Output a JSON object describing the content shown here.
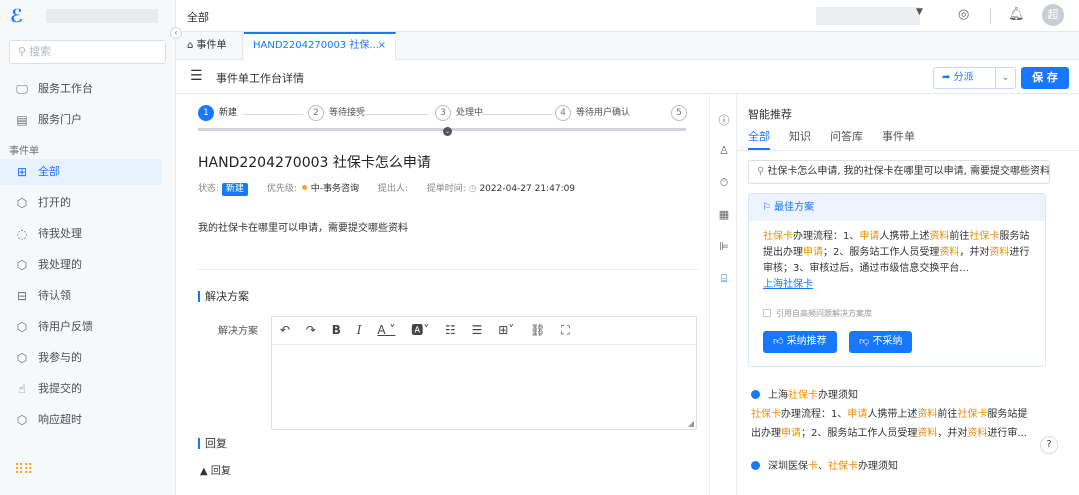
{
  "sidebar": {
    "search_placeholder": "搜索",
    "items_top": [
      {
        "label": "服务工作台",
        "icon": "monitor-icon"
      },
      {
        "label": "服务门户",
        "icon": "layout-icon"
      }
    ],
    "section": "事件单",
    "items": [
      {
        "label": "全部",
        "icon": "grid-icon",
        "active": true
      },
      {
        "label": "打开的",
        "icon": "cube-icon"
      },
      {
        "label": "待我处理",
        "icon": "circle-dashed-icon"
      },
      {
        "label": "我处理的",
        "icon": "cube-icon"
      },
      {
        "label": "待认领",
        "icon": "inbox-icon"
      },
      {
        "label": "待用户反馈",
        "icon": "cube-icon"
      },
      {
        "label": "我参与的",
        "icon": "cube-icon"
      },
      {
        "label": "我提交的",
        "icon": "hand-icon"
      },
      {
        "label": "响应超时",
        "icon": "cube-icon"
      }
    ]
  },
  "topbar": {
    "crumb": "全部",
    "avatar": "超"
  },
  "tabs": {
    "home": "事件单",
    "current": "HAND2204270003 社保...",
    "close": "×"
  },
  "page": {
    "title": "事件单工作台详情",
    "dispatch": "分派",
    "save": "保 存"
  },
  "steps": [
    {
      "num": "1",
      "label": "新建",
      "done": true
    },
    {
      "num": "2",
      "label": "等待接受",
      "done": false
    },
    {
      "num": "3",
      "label": "处理中",
      "done": false
    },
    {
      "num": "4",
      "label": "等待用户确认",
      "done": false
    },
    {
      "num": "5",
      "label": "",
      "done": false
    }
  ],
  "ticket": {
    "title": "HAND2204270003  社保卡怎么申请",
    "status_label": "状态:",
    "status": "新建",
    "priority_label": "优先级:",
    "priority": "中-事务咨询",
    "submitter_label": "提出人:",
    "submitter": "",
    "time_label": "提单时间:",
    "time": "2022-04-27 21:47:09",
    "description": "我的社保卡在哪里可以申请，需要提交哪些资料"
  },
  "solution": {
    "section": "解决方案",
    "field_label": "解决方案"
  },
  "reply": {
    "section": "回复",
    "toggle": "▲ 回复"
  },
  "recommend": {
    "title": "智能推荐",
    "tabs": [
      "全部",
      "知识",
      "问答库",
      "事件单"
    ],
    "search_value": "社保卡怎么申请, 我的社保卡在哪里可以申请, 需要提交哪些资料",
    "best": {
      "head": "最佳方案",
      "body_parts": [
        {
          "t": "社保卡",
          "h": true
        },
        {
          "t": "办理流程：1、",
          "h": false
        },
        {
          "t": "申请",
          "h": true
        },
        {
          "t": "人携带上述",
          "h": false
        },
        {
          "t": "资料",
          "h": true
        },
        {
          "t": "前往",
          "h": false
        },
        {
          "t": "社保卡",
          "h": true
        },
        {
          "t": "服务站提出办理",
          "h": false
        },
        {
          "t": "申请",
          "h": true
        },
        {
          "t": "；2、服务站工作人员受理",
          "h": false
        },
        {
          "t": "资料",
          "h": true
        },
        {
          "t": "，并对",
          "h": false
        },
        {
          "t": "资料",
          "h": true
        },
        {
          "t": "进行审核；3、审核过后，通过市级信息交换平台...",
          "h": false
        }
      ],
      "link_a": "上海",
      "link_b": "社保卡",
      "cite": "引用自高频问题解决方案库",
      "adopt": "采纳推荐",
      "reject": "不采纳"
    },
    "items": [
      {
        "title_parts": [
          {
            "t": "上海",
            "h": false
          },
          {
            "t": "社保卡",
            "h": true
          },
          {
            "t": "办理须知",
            "h": false
          }
        ],
        "sum1_parts": [
          {
            "t": "社保卡",
            "h": true
          },
          {
            "t": "办理流程：1、",
            "h": false
          },
          {
            "t": "申请",
            "h": true
          },
          {
            "t": "人携带上述",
            "h": false
          },
          {
            "t": "资料",
            "h": true
          },
          {
            "t": "前往",
            "h": false
          },
          {
            "t": "社保卡",
            "h": true
          },
          {
            "t": "服务站提",
            "h": false
          }
        ],
        "sum2_parts": [
          {
            "t": "出办理",
            "h": false
          },
          {
            "t": "申请",
            "h": true
          },
          {
            "t": "；2、服务站工作人员受理",
            "h": false
          },
          {
            "t": "资料",
            "h": true
          },
          {
            "t": "，并对",
            "h": false
          },
          {
            "t": "资料",
            "h": true
          },
          {
            "t": "进行审...",
            "h": false
          }
        ]
      },
      {
        "title_parts": [
          {
            "t": "深圳医保",
            "h": false
          },
          {
            "t": "卡",
            "h": true
          },
          {
            "t": "、",
            "h": false
          },
          {
            "t": "社保卡",
            "h": true
          },
          {
            "t": "办理须知",
            "h": false
          }
        ]
      }
    ]
  }
}
